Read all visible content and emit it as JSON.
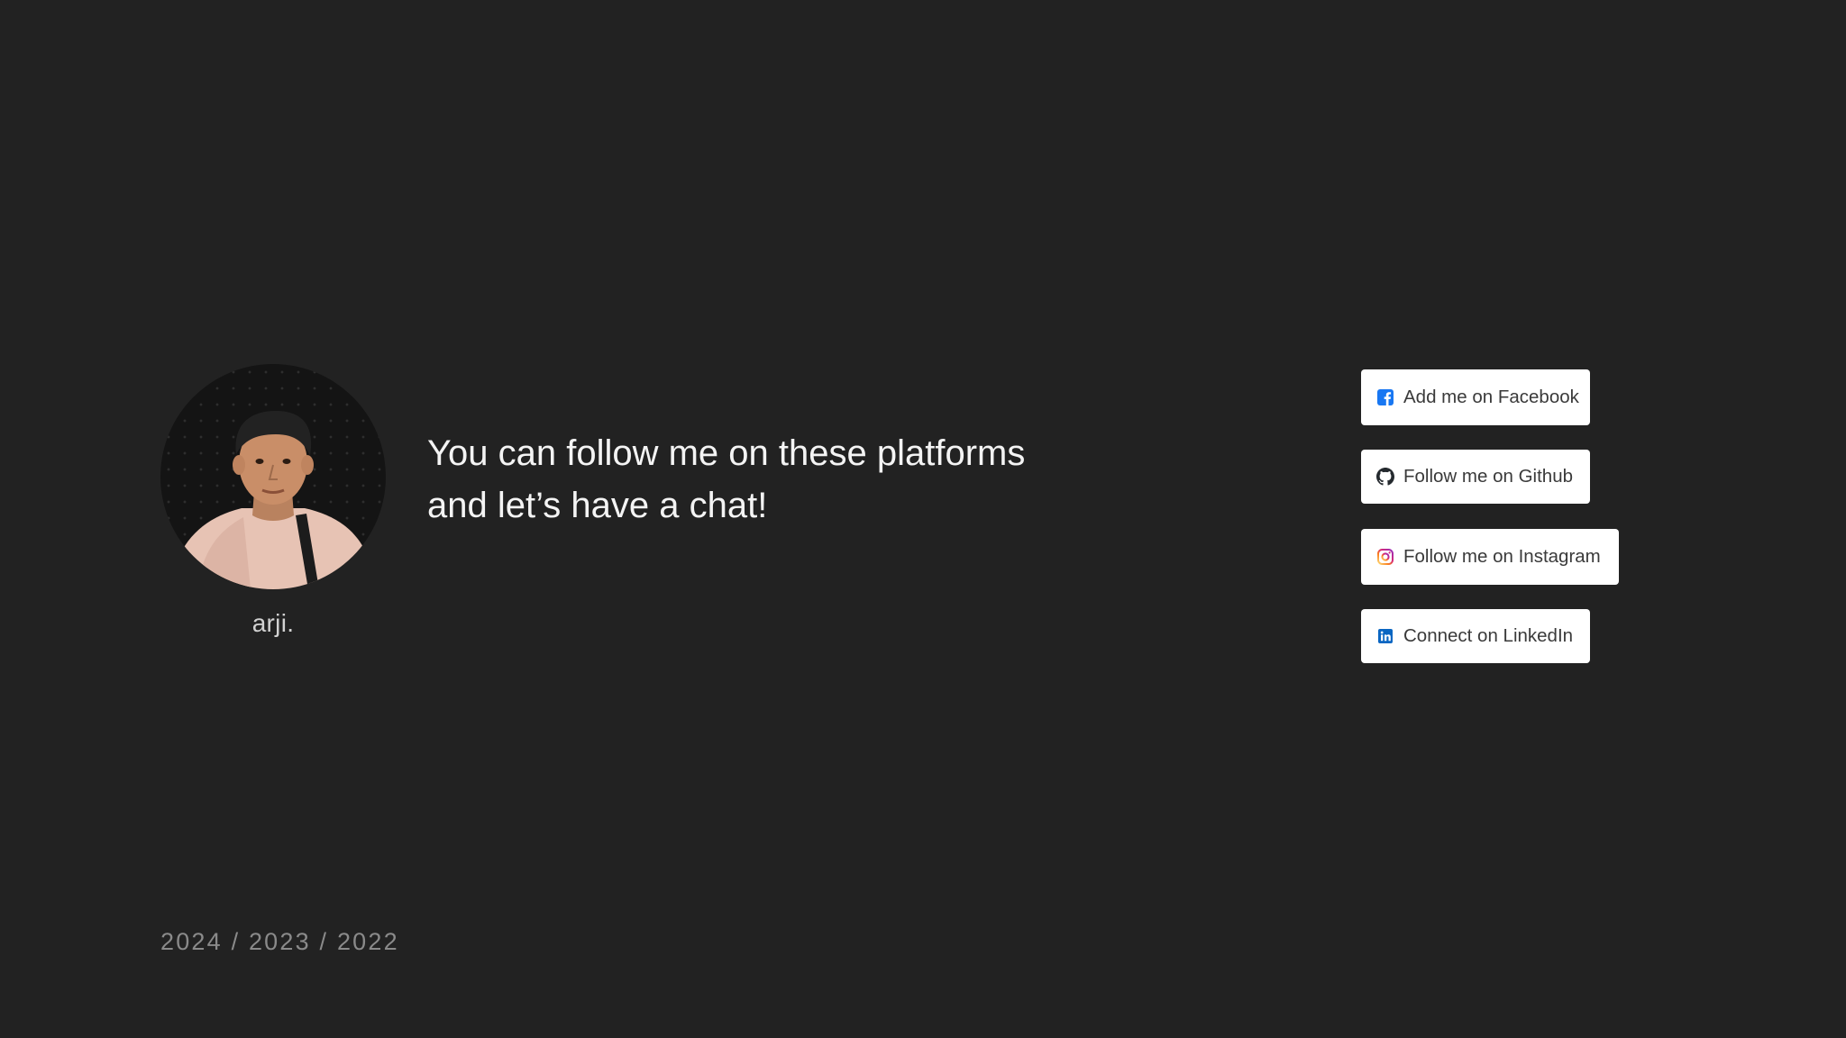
{
  "profile": {
    "name": "arji."
  },
  "headline": {
    "line1": "You can follow me on these platforms",
    "line2": "and let’s have a chat!"
  },
  "social_links": [
    {
      "label": "Add me on Facebook",
      "icon": "facebook-icon",
      "color": "#1877f2"
    },
    {
      "label": "Follow me on Github",
      "icon": "github-icon",
      "color": "#24292e"
    },
    {
      "label": "Follow me on Instagram",
      "icon": "instagram-icon",
      "color": "#e1306c"
    },
    {
      "label": "Connect on LinkedIn",
      "icon": "linkedin-icon",
      "color": "#0a66c2"
    }
  ],
  "footer": {
    "years": "2024 / 2023 / 2022"
  },
  "colors": {
    "background": "#222222",
    "button_background": "#ffffff",
    "headline_text": "#f4f4f4",
    "muted_text": "#8a8a8a"
  }
}
